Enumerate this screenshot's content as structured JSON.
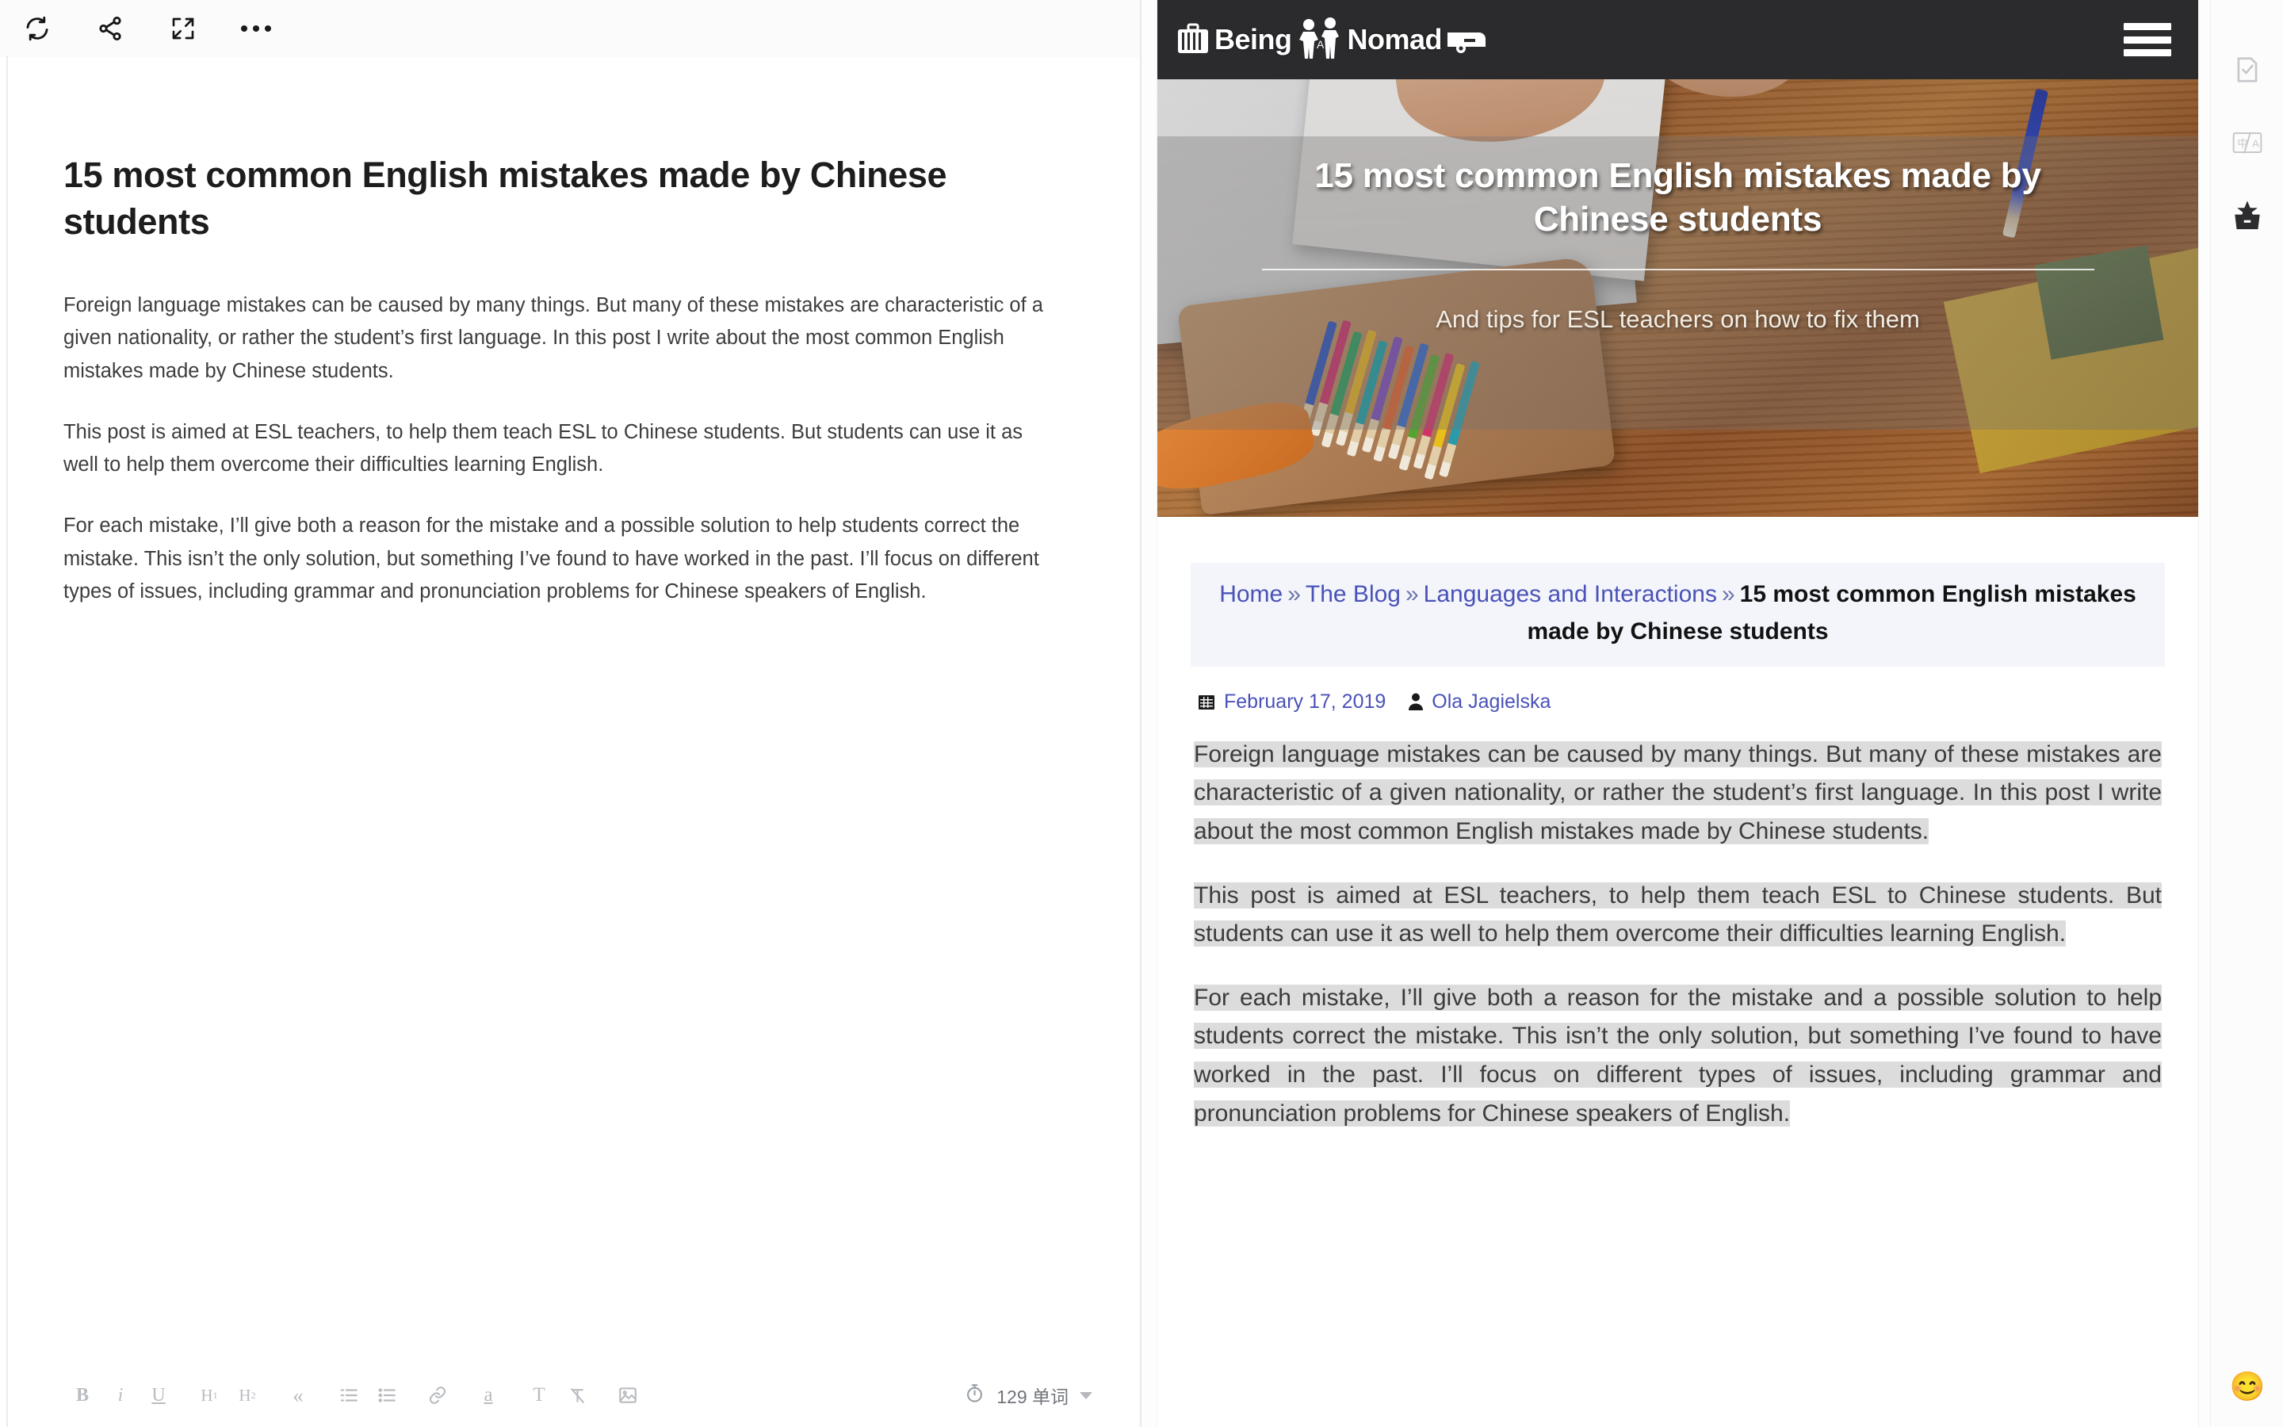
{
  "editor": {
    "toolbar": {
      "sync_label": "sync",
      "share_label": "share",
      "fullscreen_label": "fullscreen",
      "more_label": "more"
    },
    "document": {
      "title": "15 most common English mistakes made by Chinese students",
      "paragraphs": [
        "Foreign language mistakes can be caused by many things. But many of these mistakes are characteristic of a given nationality, or rather the student’s first language. In this post I write about the most common English mistakes made by Chinese students.",
        "This post is aimed at ESL teachers, to help them teach ESL to Chinese students. But students can use it as well to help them overcome their difficulties learning English.",
        "For each mistake, I’ll give both a reason for the mistake and a possible solution to help students correct the mistake. This isn’t the only solution, but something I’ve found to have worked in the past. I’ll focus on different types of issues, including grammar and pronunciation problems for Chinese speakers of English."
      ]
    },
    "format_bar": {
      "bold": "B",
      "italic": "i",
      "underline": "U",
      "heading1": "H",
      "heading1_sub": "1",
      "heading2": "H",
      "heading2_sub": "2",
      "quote": "«",
      "ordered_list": "ordered-list",
      "unordered_list": "unordered-list",
      "link": "link",
      "highlight": "a",
      "text_style": "T",
      "clear_format": "clear-format",
      "image": "image"
    },
    "word_count": "129 单词"
  },
  "preview": {
    "site": {
      "logo_text_1": "Being",
      "logo_text_2": "A",
      "logo_text_3": "Nomad",
      "menu_label": "menu"
    },
    "hero": {
      "title": "15 most common English mistakes made by Chinese students",
      "subtitle": "And tips for ESL teachers on how to fix them"
    },
    "breadcrumb": {
      "items": [
        {
          "label": "Home",
          "link": true
        },
        {
          "label": "The Blog",
          "link": true
        },
        {
          "label": "Languages and Interactions",
          "link": true
        },
        {
          "label": "15 most common English mistakes made by Chinese students",
          "link": false
        }
      ],
      "separator": "»"
    },
    "meta": {
      "date": "February 17, 2019",
      "author": "Ola Jagielska"
    },
    "paragraphs": [
      "Foreign language mistakes can be caused by many things. But many of these mistakes are characteristic of a given nationality, or rather the student’s first language. In this post I write about the most common English mistakes made by Chinese students.",
      "This post is aimed at ESL teachers, to help them teach ESL to Chinese students. But students can use it as well to help them overcome their difficulties learning English.",
      "For each mistake, I’ll give both a reason for the mistake and a possible solution to help students correct the mistake. This isn’t the only solution, but something I’ve found to have worked in the past. I’ll focus on different types of issues, including grammar and pronunciation problems for Chinese speakers of English."
    ]
  },
  "right_rail": {
    "items": [
      {
        "icon": "document-check-icon"
      },
      {
        "icon": "translate-icon"
      },
      {
        "icon": "toolbox-star-icon"
      }
    ],
    "emoji": "😊"
  },
  "colors": {
    "accent_link": "#4a52b8",
    "header_bg": "#2b2b2e",
    "selection": "#dcdcdc",
    "breadcrumb_bg": "#f3f5fb"
  }
}
